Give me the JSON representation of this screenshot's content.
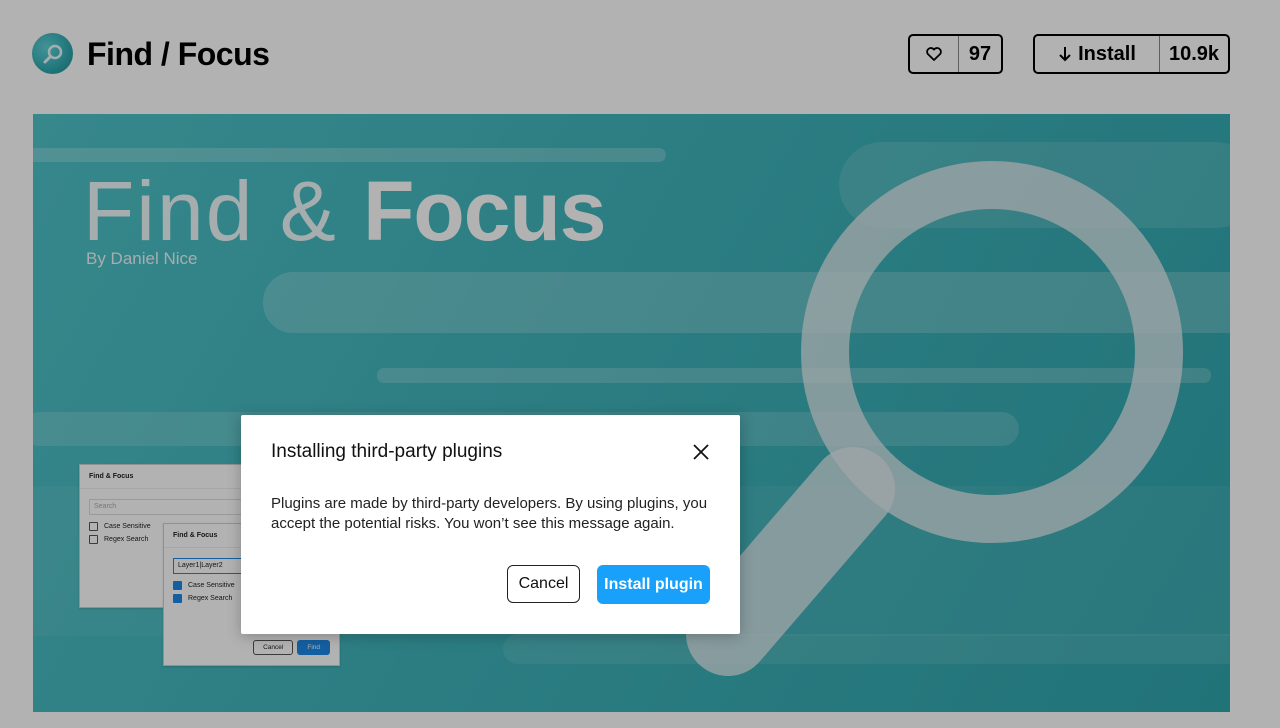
{
  "header": {
    "title": "Find / Focus",
    "like_count": "97",
    "install_label": "Install",
    "install_count": "10.9k"
  },
  "cover": {
    "title_light": "Find & ",
    "title_bold": "Focus",
    "byline": "By Daniel Nice",
    "mock_back": {
      "title": "Find & Focus",
      "search_placeholder": "Search",
      "options": [
        "Case Sensitive",
        "Regex Search"
      ]
    },
    "mock_front": {
      "title": "Find & Focus",
      "query": "Layer1|Layer2",
      "options": [
        "Case Sensitive",
        "Regex Search"
      ],
      "cancel": "Cancel",
      "find": "Find"
    }
  },
  "modal": {
    "title": "Installing third-party plugins",
    "body": "Plugins are made by third-party developers. By using plugins, you accept the potential risks. You won’t see this message again.",
    "cancel_label": "Cancel",
    "confirm_label": "Install plugin"
  },
  "colors": {
    "accent": "#18a0fb",
    "cover_teal": "#3fb4bb",
    "overlay": "rgba(0,0,0,0.30)"
  },
  "icons": {
    "plugin": "magnifier-icon",
    "like": "heart-icon",
    "install": "arrow-down-icon",
    "close": "close-icon"
  }
}
